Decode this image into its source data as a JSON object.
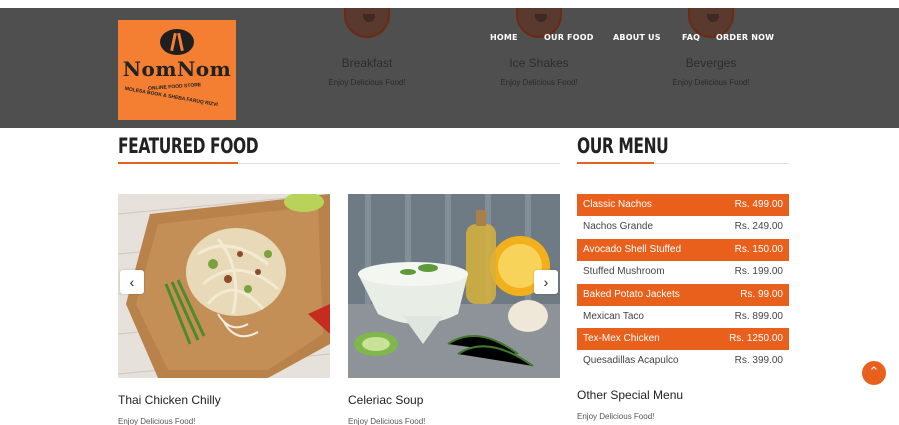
{
  "header": {
    "background_color": "#4f4f4f",
    "background_categories": [
      {
        "title": "Breakfast",
        "subtitle": "Enjoy Delicious Food!"
      },
      {
        "title": "Ice Shakes",
        "subtitle": "Enjoy Delicious Food!"
      },
      {
        "title": "Beverges",
        "subtitle": "Enjoy Delicious Food!"
      }
    ],
    "logo": {
      "name": "NomNom",
      "tagline_1": "ONLINE FOOD STORE",
      "tagline_2": "MOLESA BOOK & SHEBA FARUQ RIZVI",
      "background": "#f47f33"
    },
    "nav": [
      {
        "label": "HOME"
      },
      {
        "label": "OUR FOOD"
      },
      {
        "label": "ABOUT US"
      },
      {
        "label": "FAQ"
      },
      {
        "label": "ORDER NOW"
      }
    ]
  },
  "featured": {
    "title": "FEATURED FOOD",
    "items": [
      {
        "name": "Thai Chicken Chilly",
        "subtitle": "Enjoy Delicious Food!"
      },
      {
        "name": "Celeriac Soup",
        "subtitle": "Enjoy Delicious Food!"
      }
    ],
    "prev_icon": "chevron-left-icon",
    "next_icon": "chevron-right-icon"
  },
  "menu": {
    "title": "OUR MENU",
    "accent_color": "#e8601c",
    "items": [
      {
        "name": "Classic Nachos",
        "price": "Rs. 499.00",
        "highlight": true
      },
      {
        "name": "Nachos Grande",
        "price": "Rs. 249.00",
        "highlight": false
      },
      {
        "name": "Avocado Shell Stuffed",
        "price": "Rs. 150.00",
        "highlight": true
      },
      {
        "name": "Stuffed Mushroom",
        "price": "Rs. 199.00",
        "highlight": false
      },
      {
        "name": "Baked Potato Jackets",
        "price": "Rs. 99.00",
        "highlight": true
      },
      {
        "name": "Mexican Taco",
        "price": "Rs. 899.00",
        "highlight": false
      },
      {
        "name": "Tex-Mex Chicken",
        "price": "Rs. 1250.00",
        "highlight": true
      },
      {
        "name": "Quesadillas Acapulco",
        "price": "Rs. 399.00",
        "highlight": false
      }
    ],
    "other_title": "Other Special Menu",
    "other_subtitle": "Enjoy Delicious Food!"
  },
  "scroll_top_icon": "chevron-up-icon"
}
